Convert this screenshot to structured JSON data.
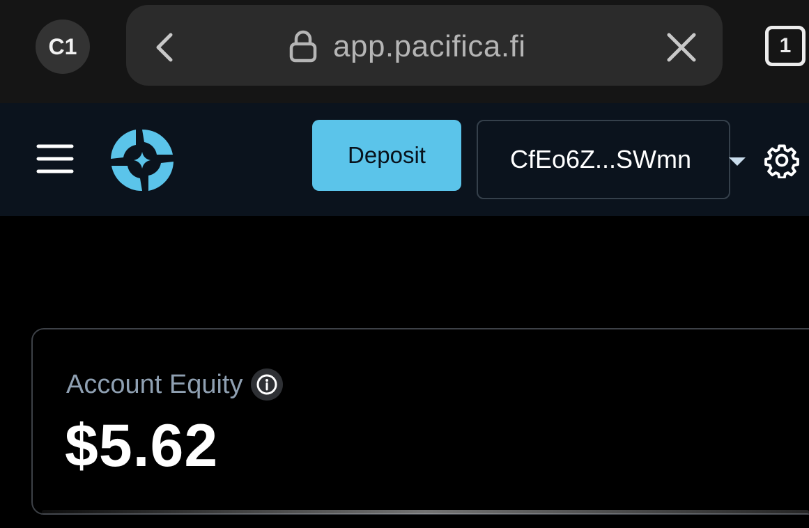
{
  "browser": {
    "profile_initials": "C1",
    "url": "app.pacifica.fi",
    "tab_count": "1",
    "icons": {
      "back": "chevron-left-icon",
      "lock": "lock-icon",
      "close": "close-icon"
    }
  },
  "header": {
    "menu_icon": "hamburger-menu-icon",
    "logo_icon": "pacifica-logo-icon",
    "deposit_label": "Deposit",
    "wallet_address": "CfEo6Z...SWmn",
    "wallet_dropdown_icon": "caret-down-icon",
    "settings_icon": "gear-icon"
  },
  "account": {
    "equity_label": "Account Equity",
    "equity_info_icon": "info-icon",
    "equity_value": "$5.62"
  },
  "colors": {
    "accent": "#5bc4ea",
    "header_bg": "#0b131d",
    "browser_bg": "#151515",
    "muted_text": "#8fa0b2"
  }
}
